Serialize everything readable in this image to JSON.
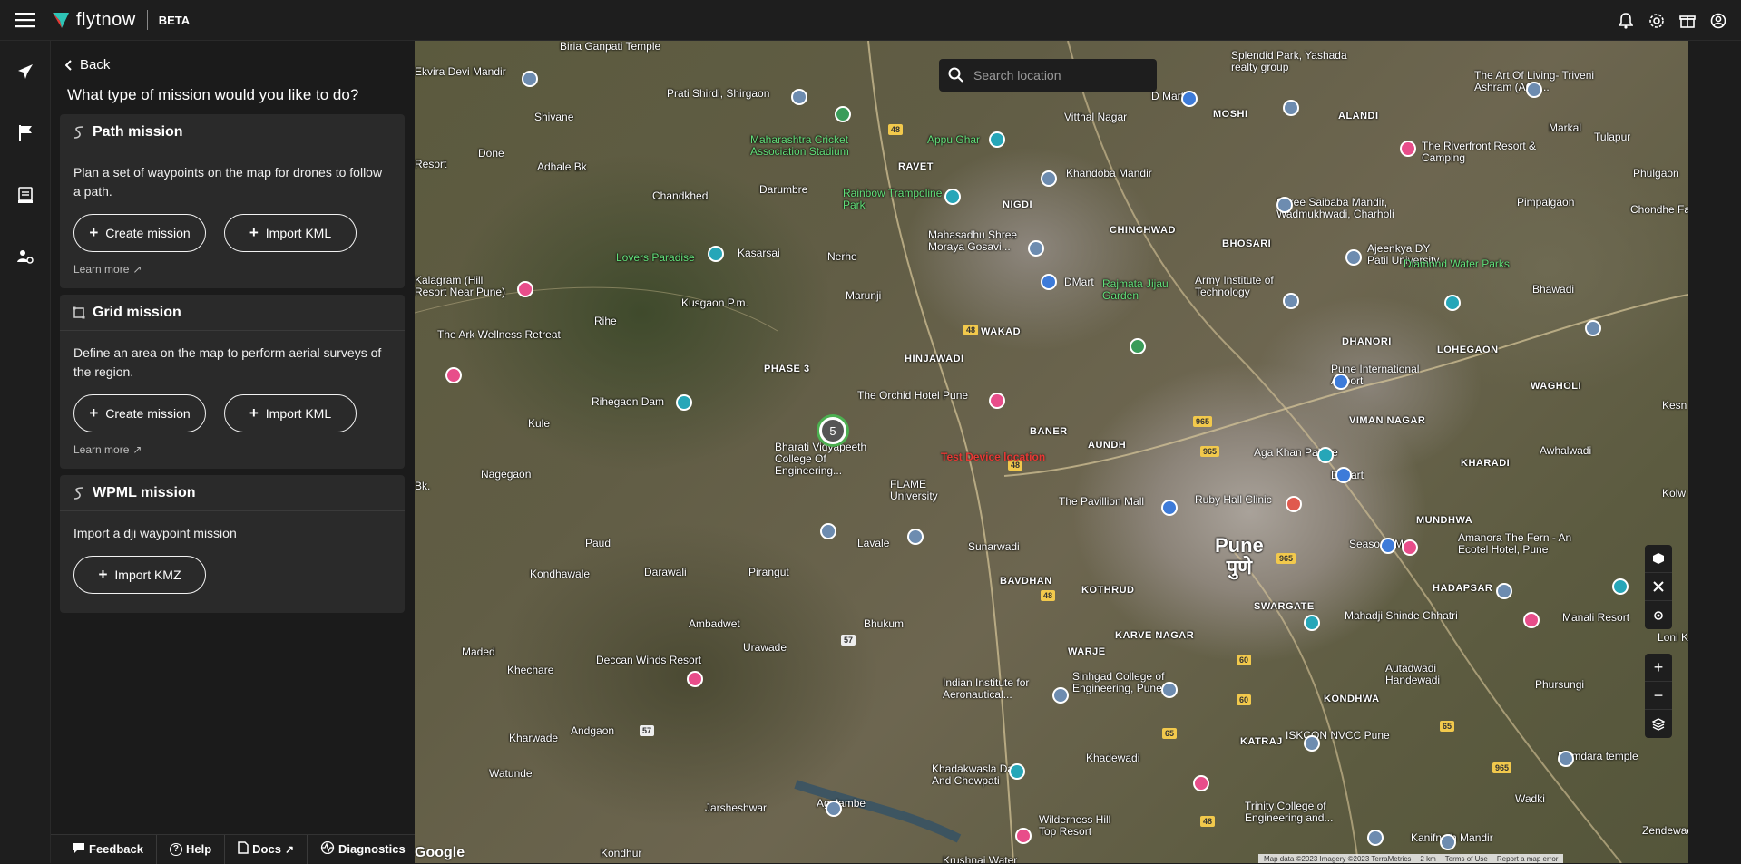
{
  "header": {
    "logo_text": "flytnow",
    "beta": "BETA"
  },
  "panel": {
    "back_label": "Back",
    "question": "What type of mission would you like to do?",
    "cards": [
      {
        "title": "Path mission",
        "desc": "Plan a set of waypoints on the map for drones to follow a path.",
        "btn1": "Create mission",
        "btn2": "Import KML",
        "learn": "Learn more"
      },
      {
        "title": "Grid mission",
        "desc": "Define an area on the map to perform aerial surveys of the region.",
        "btn1": "Create mission",
        "btn2": "Import KML",
        "learn": "Learn more"
      },
      {
        "title": "WPML mission",
        "desc": "Import a dji waypoint mission",
        "btn1": "Import KMZ"
      }
    ]
  },
  "bottom_bar": {
    "feedback": "Feedback",
    "help": "Help",
    "docs": "Docs",
    "diagnostics": "Diagnostics"
  },
  "map": {
    "search_placeholder": "Search location",
    "cluster_count": "5",
    "test_label": "Test Device location",
    "google": "Google",
    "attribution": {
      "data": "Map data ©2023 Imagery ©2023 TerraMetrics",
      "scale": "2 km",
      "terms": "Terms of Use",
      "report": "Report a map error"
    },
    "labels": {
      "city": "Pune",
      "city_local": "पुणे",
      "l1": "Ekvira Devi Mandir",
      "l2": "Biria Ganpati Temple",
      "l3": "Prati Shirdi, Shirgaon",
      "l4": "Shivane",
      "l5": "Adhale Bk",
      "l6": "Done",
      "l7": "Maharashtra Cricket Association Stadium",
      "l8": "Appu Ghar",
      "l9": "Vitthal Nagar",
      "l10": "Khandoba Mandir",
      "l11": "Splendid Park, Yashada realty group",
      "l12": "The Art Of Living- Triveni Ashram (AOL...",
      "l13": "The Riverfront Resort & Camping",
      "l14": "Markal",
      "l15": "Tulapur",
      "l16": "Phulgaon",
      "l17": "Chandkhed",
      "l18": "Darumbre",
      "l19": "Rainbow Trampoline Park",
      "l20": "Shree Saibaba Mandir, Wadmukhwadi, Charholi",
      "l21": "Pimpalgaon",
      "l22": "Chondhe Farms",
      "l23": "Lovers Paradise",
      "l24": "Kasarsai",
      "l25": "Nerhe",
      "l26": "Mahasadhu Shree Moraya Gosavi...",
      "l27": "DMart",
      "l28": "Rajmata Jijau Garden",
      "l29": "Army Institute of Technology",
      "l30": "Ajeenkya DY Patil University",
      "l31": "Diamond Water Parks",
      "l32": "Bhawadi",
      "l33": "Kalagram (Hill Resort Near Pune)",
      "l34": "Kusgaon P.m.",
      "l35": "Marunji",
      "l36": "The Ark Wellness Retreat",
      "l37": "Rihe",
      "l38": "PHASE 3",
      "l39": "Pune International Airport",
      "l40": "WAGHOLI",
      "l41": "The Orchid Hotel Pune",
      "l42": "Rihegaon Dam",
      "l43": "VIMAN NAGAR",
      "l44": "Aga Khan Palace",
      "l45": "Awhalwadi",
      "l46": "Kule",
      "l47": "Bharati Vidyapeeth College Of Engineering...",
      "l48": "Nagegaon",
      "l49": "FLAME University",
      "l50": "The Pavillion Mall",
      "l51": "Ruby Hall Clinic",
      "l52": "D Mart",
      "l53": "Paud",
      "l54": "Lavale",
      "l55": "Sunarwadi",
      "l56": "Seasons Mall",
      "l57": "Amanora The Fern - An Ecotel Hotel, Pune",
      "l58": "Kondhawale",
      "l59": "Darawali",
      "l60": "Pirangut",
      "l61": "KOTHRUD",
      "l62": "SWARGATE",
      "l63": "Mahadji Shinde Chhatri",
      "l64": "Manali Resort",
      "l65": "Ambadwet",
      "l66": "Bhukum",
      "l67": "Maded",
      "l68": "Khechare",
      "l69": "Deccan Winds Resort",
      "l70": "Urawade",
      "l71": "Indian Institute for Aeronautical...",
      "l72": "Sinhgad College of Engineering, Pune",
      "l73": "Autadwadi Handewadi",
      "l74": "Phursungi",
      "l75": "Kharwade",
      "l76": "Andgaon",
      "l77": "ISKCON NVCC Pune",
      "l78": "Ramdara temple",
      "l79": "Watunde",
      "l80": "Khadakwasla Dam And Chowpati",
      "l81": "Khadewadi",
      "l82": "Jarsheshwar",
      "l83": "Agalambe",
      "l84": "Wilderness Hill Top Resort",
      "l85": "Trinity College of Engineering and...",
      "l86": "Kanifnath Mandir",
      "l87": "Wadki",
      "l88": "Zendewadi",
      "l89": "Kondhur",
      "l90": "Krushnai Water",
      "l91": "KATRAJ",
      "l92": "KHARADI",
      "l93": "LOHEGAON",
      "l94": "DHANORI",
      "l95": "BHOSARI",
      "l96": "CHINCHWAD",
      "l97": "NIGDI",
      "l98": "RAVET",
      "l99": "WAKAD",
      "l100": "HINJAWADI",
      "l101": "BANER",
      "l102": "AUNDH",
      "l103": "BAVDHAN",
      "l104": "WARJE",
      "l105": "KARVE NAGAR",
      "l106": "KONDHWA",
      "l107": "HADAPSAR",
      "l108": "MUNDHWA",
      "l109": "ALANDI",
      "l110": "MOSHI",
      "l111": "D Mart",
      "l112": "Loni Ka",
      "l113": "Kesn",
      "l114": "Kolw",
      "l115": "Bk.",
      "l116": "Resort"
    },
    "roads": [
      "48",
      "48",
      "48",
      "48",
      "965",
      "965",
      "965",
      "60",
      "60",
      "65",
      "65",
      "965",
      "48",
      "57",
      "57",
      "48"
    ]
  },
  "colors": {
    "accent_green": "#4caf50",
    "test_red": "#e53935"
  }
}
